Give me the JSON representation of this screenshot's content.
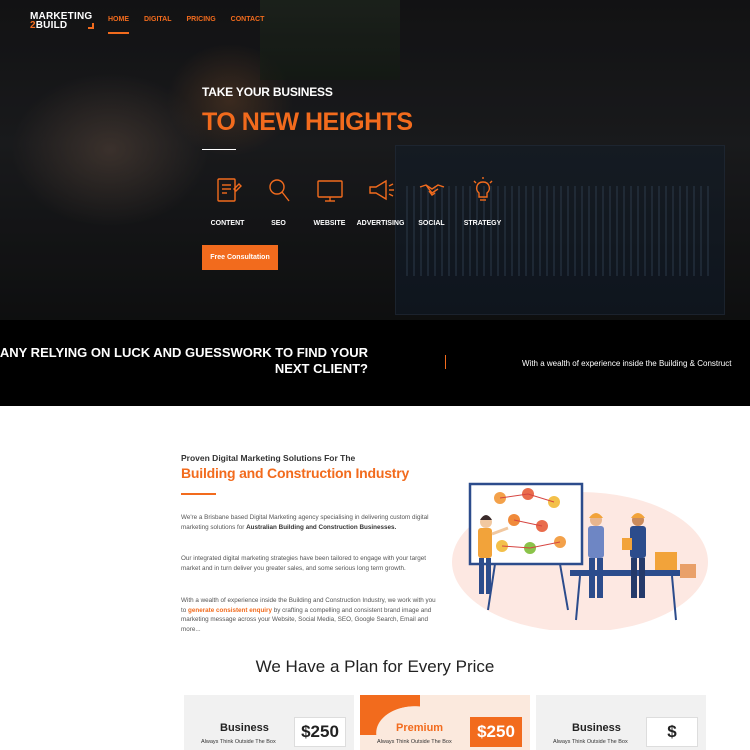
{
  "brand": {
    "line1": "MARKETING",
    "line2_num": "2",
    "line2_word": "BUILD"
  },
  "nav": [
    "HOME",
    "DIGITAL",
    "PRICING",
    "CONTACT"
  ],
  "hero": {
    "subtitle": "TAKE YOUR BUSINESS",
    "title": "TO NEW HEIGHTS",
    "services": [
      {
        "label": "CONTENT",
        "icon": "content-icon"
      },
      {
        "label": "SEO",
        "icon": "seo-icon"
      },
      {
        "label": "WEBSITE",
        "icon": "website-icon"
      },
      {
        "label": "ADVERTISING",
        "icon": "advertising-icon"
      },
      {
        "label": "SOCIAL",
        "icon": "social-icon"
      },
      {
        "label": "STRATEGY",
        "icon": "strategy-icon"
      }
    ],
    "cta": "Free Consultation"
  },
  "ticker": {
    "question_line1": "ANY RELYING ON LUCK AND GUESSWORK TO FIND YOUR",
    "question_line2": "NEXT CLIENT?",
    "message": "With a wealth of experience inside the Building & Construct"
  },
  "about": {
    "pretitle": "Proven Digital Marketing Solutions For The",
    "title": "Building and Construction Industry",
    "p1_a": "We're a Brisbane based Digital Marketing agency specialising in delivering custom digital marketing solutions for ",
    "p1_b": "Australian Building and Construction Businesses.",
    "p2": "Our integrated digital marketing strategies have been tailored to engage with your target market and in turn deliver you greater sales, and some serious long term growth.",
    "p3_a": "With a wealth of experience inside the Building and Construction Industry, we work with you to ",
    "p3_b": "generate consistent enquiry",
    "p3_c": " by crafting a compelling and consistent brand image and marketing message across your Website, Social Media, SEO, Google Search, Email and more..."
  },
  "pricing": {
    "title": "We Have a Plan for Every Price",
    "plans": [
      {
        "name": "Business",
        "tagline": "Always Think Outside The Box",
        "price": "$250"
      },
      {
        "name": "Premium",
        "tagline": "Always Think Outside The Box",
        "price": "$250"
      },
      {
        "name": "Business",
        "tagline": "Always Think Outside The Box",
        "price": "$"
      }
    ]
  },
  "colors": {
    "accent": "#f26b1d",
    "dark": "#000000"
  }
}
